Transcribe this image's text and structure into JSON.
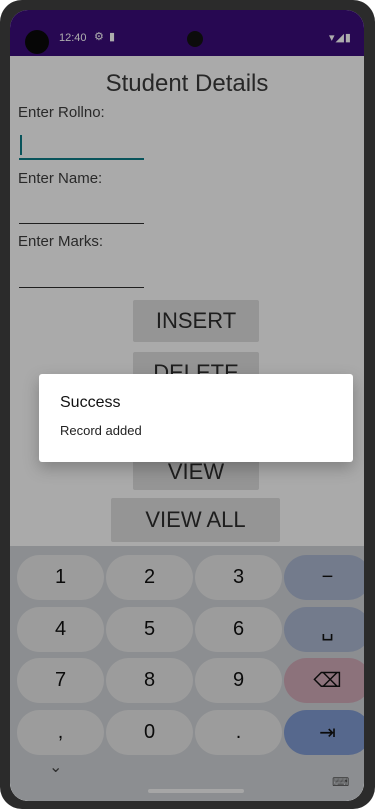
{
  "status": {
    "time": "12:40",
    "icons": [
      "settings-icon",
      "clipboard-icon",
      "wifi-icon",
      "signal-icon",
      "battery-icon"
    ]
  },
  "app": {
    "title": "Student Details",
    "labels": {
      "rollno": "Enter Rollno:",
      "name": "Enter Name:",
      "marks": "Enter Marks:"
    },
    "inputs": {
      "rollno_value": "",
      "name_value": "",
      "marks_value": ""
    },
    "buttons": {
      "insert": "INSERT",
      "delete": "DELETE",
      "view": "VIEW",
      "view_all": "VIEW ALL"
    }
  },
  "dialog": {
    "title": "Success",
    "message": "Record added"
  },
  "keyboard": {
    "row1": [
      "1",
      "2",
      "3",
      "−"
    ],
    "row2": [
      "4",
      "5",
      "6",
      "␣"
    ],
    "row3": [
      "7",
      "8",
      "9",
      "⌫"
    ],
    "row4": [
      ",",
      "0",
      ".",
      "⇥"
    ]
  },
  "navigation": {
    "collapse_label": "⌄",
    "keyboard_label": "⌨"
  },
  "colors": {
    "status_bar": "#3a0d7a",
    "accent": "#0e7c86",
    "button_bg": "#dcdcdc"
  }
}
